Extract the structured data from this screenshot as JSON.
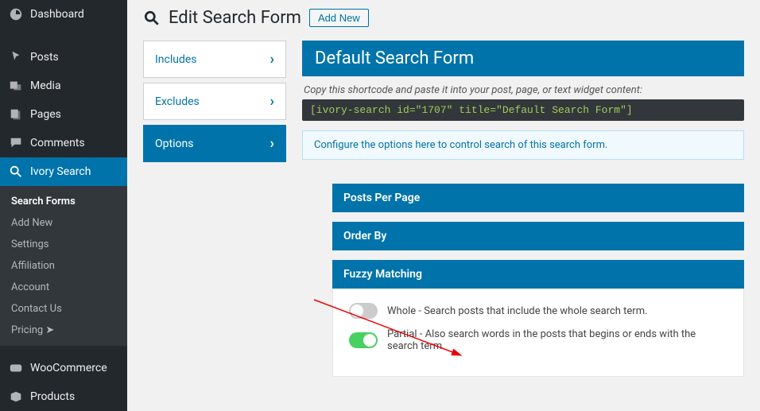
{
  "sidebar": {
    "items": [
      {
        "label": "Dashboard"
      },
      {
        "label": "Posts"
      },
      {
        "label": "Media"
      },
      {
        "label": "Pages"
      },
      {
        "label": "Comments"
      },
      {
        "label": "Ivory Search"
      }
    ],
    "submenu": [
      {
        "label": "Search Forms"
      },
      {
        "label": "Add New"
      },
      {
        "label": "Settings"
      },
      {
        "label": "Affiliation"
      },
      {
        "label": "Account"
      },
      {
        "label": "Contact Us"
      },
      {
        "label": "Pricing ➤"
      }
    ],
    "woo": [
      {
        "label": "WooCommerce"
      },
      {
        "label": "Products"
      }
    ]
  },
  "header": {
    "title": "Edit Search Form",
    "add_new": "Add New"
  },
  "tabs": [
    {
      "label": "Includes"
    },
    {
      "label": "Excludes"
    },
    {
      "label": "Options"
    }
  ],
  "main": {
    "title": "Default Search Form",
    "note": "Copy this shortcode and paste it into your post, page, or text widget content:",
    "shortcode": "[ivory-search id=\"1707\" title=\"Default Search Form\"]",
    "info": "Configure the options here to control search of this search form."
  },
  "sections": {
    "posts_per_page": "Posts Per Page",
    "order_by": "Order By",
    "fuzzy": "Fuzzy Matching",
    "fuzzy_whole": "Whole - Search posts that include the whole search term.",
    "fuzzy_partial": "Partial - Also search words in the posts that begins or ends with the search term."
  }
}
